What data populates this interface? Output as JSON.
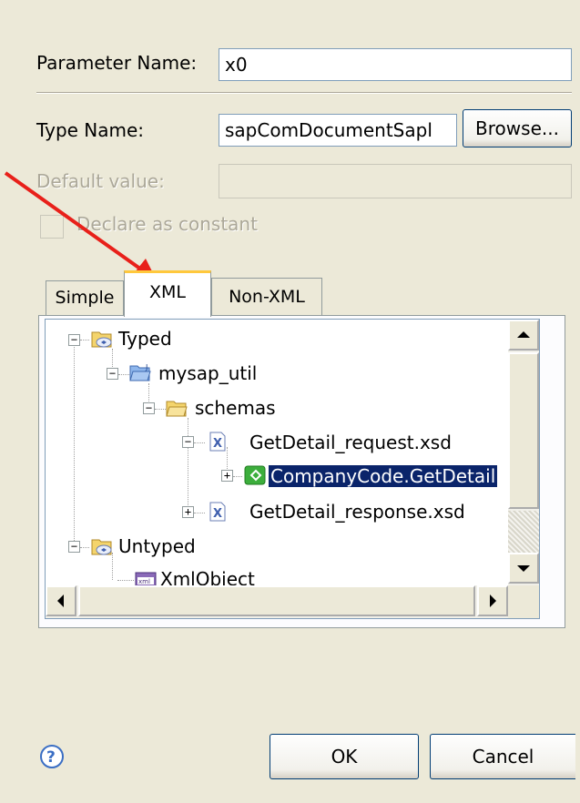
{
  "form": {
    "param_label": "Parameter Name:",
    "param_value": "x0",
    "type_label": "Type Name:",
    "type_value": "sapComDocumentSapl",
    "browse_label": "Browse...",
    "default_label": "Default value:",
    "default_value": "",
    "constant_label": "Declare as constant"
  },
  "tabs": [
    {
      "label": "Simple"
    },
    {
      "label": "XML"
    },
    {
      "label": "Non-XML"
    }
  ],
  "tree": {
    "typed": "Typed",
    "mysap_util": "mysap_util",
    "schemas": "schemas",
    "req_xsd": "GetDetail_request.xsd",
    "company": "CompanyCode.GetDetail",
    "resp_xsd": "GetDetail_response.xsd",
    "untyped": "Untyped",
    "xmlobject": "XmlObject"
  },
  "buttons": {
    "ok": "OK",
    "cancel": "Cancel"
  },
  "colors": {
    "dialog_bg": "#ece9d8",
    "selection": "#0a246a",
    "annotation_arrow": "#e8201a"
  }
}
